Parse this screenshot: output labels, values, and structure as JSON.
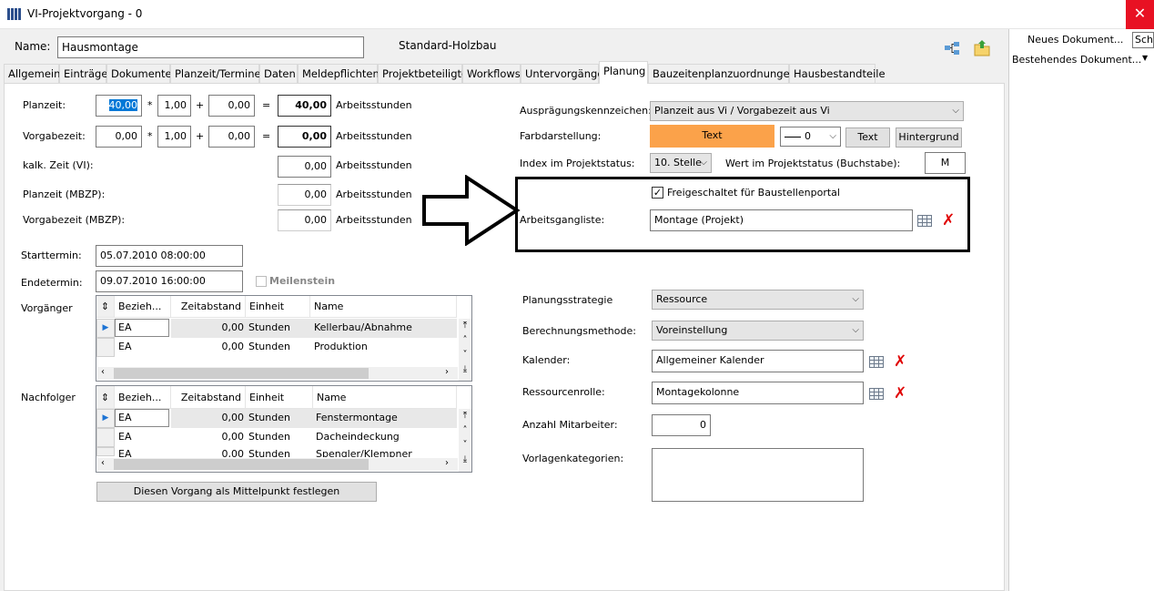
{
  "window": {
    "title": "VI-Projektvorgang - 0",
    "close": "✕"
  },
  "header": {
    "name_label": "Name:",
    "name_value": "Hausmontage",
    "type_text": "Standard-Holzbau"
  },
  "tabs": [
    "Allgemein",
    "Einträge",
    "Dokumente",
    "Planzeit/Termine",
    "Daten",
    "Meldepflichten",
    "Projektbeteiligte",
    "Workflows",
    "Untervorgänge",
    "Planung",
    "Bauzeitenplanzuordnungen",
    "Hausbestandteile"
  ],
  "active_tab": "Planung",
  "times": {
    "planzeit_label": "Planzeit:",
    "planzeit_value": "40,00",
    "planzeit_factor": "1,00",
    "planzeit_add": "0,00",
    "planzeit_result": "40,00",
    "vorgabe_label": "Vorgabezeit:",
    "vorgabe_value": "0,00",
    "vorgabe_factor": "1,00",
    "vorgabe_add": "0,00",
    "vorgabe_result": "0,00",
    "kalk_label": "kalk. Zeit (VI):",
    "kalk_value": "0,00",
    "mbzp_plan_label": "Planzeit (MBZP):",
    "mbzp_plan_value": "0,00",
    "mbzp_vorgabe_label": "Vorgabezeit (MBZP):",
    "mbzp_vorgabe_value": "0,00",
    "unit": "Arbeitsstunden",
    "mul": "*",
    "plus": "+",
    "eq": "="
  },
  "dates": {
    "start_label": "Starttermin:",
    "start_value": "05.07.2010 08:00:00",
    "end_label": "Endetermin:",
    "end_value": "09.07.2010 16:00:00",
    "milestone_label": "Meilenstein"
  },
  "predecessors": {
    "label": "Vorgänger",
    "columns": [
      "Bezieh...",
      "Zeitabstand",
      "Einheit",
      "Name"
    ],
    "rows": [
      {
        "rel": "EA",
        "gap": "0,00",
        "unit": "Stunden",
        "name": "Kellerbau/Abnahme"
      },
      {
        "rel": "EA",
        "gap": "0,00",
        "unit": "Stunden",
        "name": "Produktion"
      }
    ]
  },
  "successors": {
    "label": "Nachfolger",
    "columns": [
      "Bezieh...",
      "Zeitabstand",
      "Einheit",
      "Name"
    ],
    "rows": [
      {
        "rel": "EA",
        "gap": "0,00",
        "unit": "Stunden",
        "name": "Fenstermontage"
      },
      {
        "rel": "EA",
        "gap": "0,00",
        "unit": "Stunden",
        "name": "Dacheindeckung"
      },
      {
        "rel": "EA",
        "gap": "0,00",
        "unit": "Stunden",
        "name": "Spengler/Klempner"
      }
    ]
  },
  "center_button": "Diesen Vorgang als Mittelpunkt festlegen",
  "right": {
    "auspraegung_label": "Ausprägungskennzeichen:",
    "auspraegung_value": "Planzeit aus Vi / Vorgabezeit aus Vi",
    "farb_label": "Farbdarstellung:",
    "farb_text": "Text",
    "farb_color": "#fba24a",
    "line_value": "0",
    "text_button": "Text",
    "bg_button": "Hintergrund",
    "index_label": "Index im Projektstatus:",
    "index_value": "10. Stelle",
    "wert_label": "Wert im Projektstatus (Buchstabe):",
    "wert_value": "M",
    "portal_label": "Freigeschaltet für Baustellenportal",
    "ag_label": "Arbeitsgangliste:",
    "ag_value": "Montage (Projekt)",
    "strategie_label": "Planungsstrategie",
    "strategie_value": "Ressource",
    "methode_label": "Berechnungsmethode:",
    "methode_value": "Voreinstellung",
    "kalender_label": "Kalender:",
    "kalender_value": "Allgemeiner Kalender",
    "rolle_label": "Ressourcenrolle:",
    "rolle_value": "Montagekolonne",
    "mitarbeiter_label": "Anzahl Mitarbeiter:",
    "mitarbeiter_value": "0",
    "vorlagen_label": "Vorlagenkategorien:"
  },
  "sidepane": {
    "new_doc": "Neues Dokument...",
    "existing_doc": "Bestehendes Dokument...",
    "tooltip": "Sch"
  }
}
